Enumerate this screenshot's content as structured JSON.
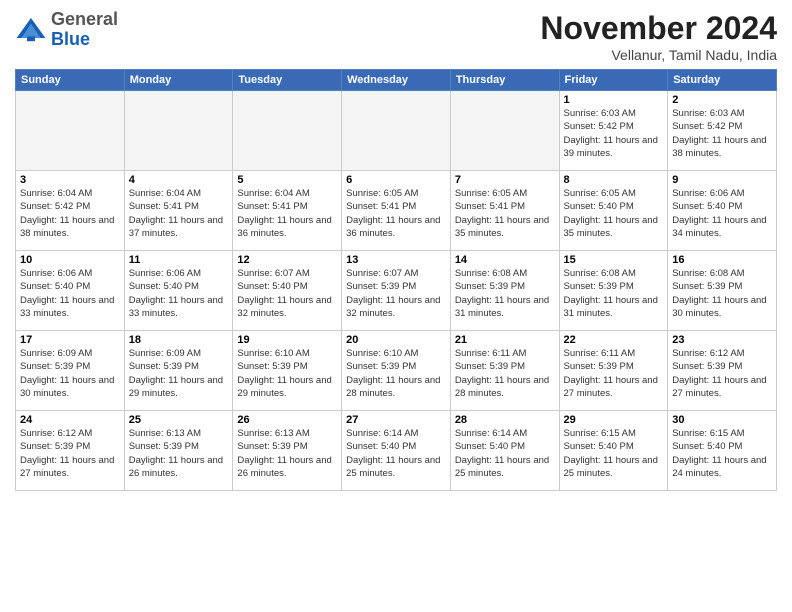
{
  "logo": {
    "general": "General",
    "blue": "Blue"
  },
  "title": "November 2024",
  "subtitle": "Vellanur, Tamil Nadu, India",
  "days_of_week": [
    "Sunday",
    "Monday",
    "Tuesday",
    "Wednesday",
    "Thursday",
    "Friday",
    "Saturday"
  ],
  "weeks": [
    [
      {
        "day": "",
        "info": ""
      },
      {
        "day": "",
        "info": ""
      },
      {
        "day": "",
        "info": ""
      },
      {
        "day": "",
        "info": ""
      },
      {
        "day": "",
        "info": ""
      },
      {
        "day": "1",
        "info": "Sunrise: 6:03 AM\nSunset: 5:42 PM\nDaylight: 11 hours and 39 minutes."
      },
      {
        "day": "2",
        "info": "Sunrise: 6:03 AM\nSunset: 5:42 PM\nDaylight: 11 hours and 38 minutes."
      }
    ],
    [
      {
        "day": "3",
        "info": "Sunrise: 6:04 AM\nSunset: 5:42 PM\nDaylight: 11 hours and 38 minutes."
      },
      {
        "day": "4",
        "info": "Sunrise: 6:04 AM\nSunset: 5:41 PM\nDaylight: 11 hours and 37 minutes."
      },
      {
        "day": "5",
        "info": "Sunrise: 6:04 AM\nSunset: 5:41 PM\nDaylight: 11 hours and 36 minutes."
      },
      {
        "day": "6",
        "info": "Sunrise: 6:05 AM\nSunset: 5:41 PM\nDaylight: 11 hours and 36 minutes."
      },
      {
        "day": "7",
        "info": "Sunrise: 6:05 AM\nSunset: 5:41 PM\nDaylight: 11 hours and 35 minutes."
      },
      {
        "day": "8",
        "info": "Sunrise: 6:05 AM\nSunset: 5:40 PM\nDaylight: 11 hours and 35 minutes."
      },
      {
        "day": "9",
        "info": "Sunrise: 6:06 AM\nSunset: 5:40 PM\nDaylight: 11 hours and 34 minutes."
      }
    ],
    [
      {
        "day": "10",
        "info": "Sunrise: 6:06 AM\nSunset: 5:40 PM\nDaylight: 11 hours and 33 minutes."
      },
      {
        "day": "11",
        "info": "Sunrise: 6:06 AM\nSunset: 5:40 PM\nDaylight: 11 hours and 33 minutes."
      },
      {
        "day": "12",
        "info": "Sunrise: 6:07 AM\nSunset: 5:40 PM\nDaylight: 11 hours and 32 minutes."
      },
      {
        "day": "13",
        "info": "Sunrise: 6:07 AM\nSunset: 5:39 PM\nDaylight: 11 hours and 32 minutes."
      },
      {
        "day": "14",
        "info": "Sunrise: 6:08 AM\nSunset: 5:39 PM\nDaylight: 11 hours and 31 minutes."
      },
      {
        "day": "15",
        "info": "Sunrise: 6:08 AM\nSunset: 5:39 PM\nDaylight: 11 hours and 31 minutes."
      },
      {
        "day": "16",
        "info": "Sunrise: 6:08 AM\nSunset: 5:39 PM\nDaylight: 11 hours and 30 minutes."
      }
    ],
    [
      {
        "day": "17",
        "info": "Sunrise: 6:09 AM\nSunset: 5:39 PM\nDaylight: 11 hours and 30 minutes."
      },
      {
        "day": "18",
        "info": "Sunrise: 6:09 AM\nSunset: 5:39 PM\nDaylight: 11 hours and 29 minutes."
      },
      {
        "day": "19",
        "info": "Sunrise: 6:10 AM\nSunset: 5:39 PM\nDaylight: 11 hours and 29 minutes."
      },
      {
        "day": "20",
        "info": "Sunrise: 6:10 AM\nSunset: 5:39 PM\nDaylight: 11 hours and 28 minutes."
      },
      {
        "day": "21",
        "info": "Sunrise: 6:11 AM\nSunset: 5:39 PM\nDaylight: 11 hours and 28 minutes."
      },
      {
        "day": "22",
        "info": "Sunrise: 6:11 AM\nSunset: 5:39 PM\nDaylight: 11 hours and 27 minutes."
      },
      {
        "day": "23",
        "info": "Sunrise: 6:12 AM\nSunset: 5:39 PM\nDaylight: 11 hours and 27 minutes."
      }
    ],
    [
      {
        "day": "24",
        "info": "Sunrise: 6:12 AM\nSunset: 5:39 PM\nDaylight: 11 hours and 27 minutes."
      },
      {
        "day": "25",
        "info": "Sunrise: 6:13 AM\nSunset: 5:39 PM\nDaylight: 11 hours and 26 minutes."
      },
      {
        "day": "26",
        "info": "Sunrise: 6:13 AM\nSunset: 5:39 PM\nDaylight: 11 hours and 26 minutes."
      },
      {
        "day": "27",
        "info": "Sunrise: 6:14 AM\nSunset: 5:40 PM\nDaylight: 11 hours and 25 minutes."
      },
      {
        "day": "28",
        "info": "Sunrise: 6:14 AM\nSunset: 5:40 PM\nDaylight: 11 hours and 25 minutes."
      },
      {
        "day": "29",
        "info": "Sunrise: 6:15 AM\nSunset: 5:40 PM\nDaylight: 11 hours and 25 minutes."
      },
      {
        "day": "30",
        "info": "Sunrise: 6:15 AM\nSunset: 5:40 PM\nDaylight: 11 hours and 24 minutes."
      }
    ]
  ]
}
